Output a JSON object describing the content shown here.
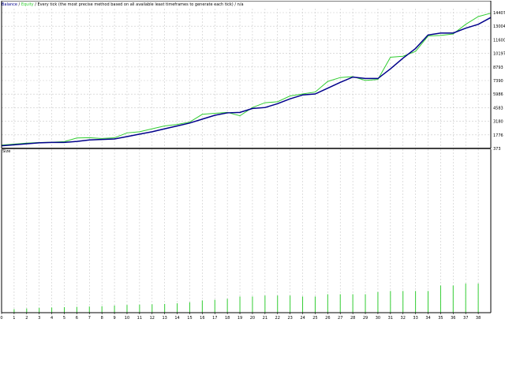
{
  "header": {
    "balance_label": "Balance",
    "sep1": " / ",
    "equity_label": "Equity",
    "sep2": " / ",
    "model_text": "Every tick (the most precise method based on all available least timeframes to generate each tick)",
    "sep3": " / ",
    "tail_text": "n/a"
  },
  "colors": {
    "balance": "#00008b",
    "equity": "#32cd32",
    "size_bars": "#32cd32",
    "grid": "#c8c8c8",
    "axis": "#000000"
  },
  "chart_data": [
    {
      "type": "line",
      "title": "",
      "xlabel": "",
      "ylabel": "",
      "ylim": [
        373,
        14407
      ],
      "yticks": [
        "14407",
        "13004",
        "11600",
        "10197",
        "8793",
        "7390",
        "5986",
        "4583",
        "3180",
        "1776",
        "373"
      ],
      "x": [
        0,
        1,
        2,
        3,
        4,
        5,
        6,
        7,
        8,
        9,
        10,
        11,
        12,
        13,
        14,
        15,
        16,
        17,
        18,
        19,
        20,
        21,
        22,
        23,
        24,
        25,
        26,
        27,
        28,
        29,
        30,
        31,
        32,
        33,
        34,
        35,
        36,
        37,
        38,
        39
      ],
      "series": [
        {
          "name": "Balance",
          "color": "#00008b",
          "values": [
            650,
            750,
            850,
            950,
            1000,
            1000,
            1100,
            1250,
            1300,
            1350,
            1600,
            1850,
            2100,
            2400,
            2700,
            3000,
            3400,
            3800,
            4050,
            4100,
            4500,
            4600,
            5000,
            5500,
            5900,
            6000,
            6600,
            7200,
            7750,
            7600,
            7600,
            8600,
            9700,
            10700,
            12100,
            12300,
            12300,
            12800,
            13200,
            13900
          ]
        },
        {
          "name": "Equity",
          "color": "#32cd32",
          "values": [
            720,
            820,
            920,
            990,
            1020,
            1080,
            1450,
            1480,
            1400,
            1470,
            1980,
            2100,
            2400,
            2700,
            2850,
            3100,
            3900,
            4000,
            4100,
            3750,
            4600,
            5100,
            5200,
            5800,
            6000,
            6200,
            7300,
            7700,
            7800,
            7400,
            7500,
            9800,
            9900,
            10400,
            12000,
            12050,
            12200,
            13200,
            14000,
            14350
          ]
        }
      ]
    },
    {
      "type": "bar",
      "title": "Size",
      "xlabel": "",
      "ylabel": "",
      "ylim": [
        0,
        1
      ],
      "xticks": [
        "0",
        "1",
        "2",
        "3",
        "4",
        "5",
        "6",
        "7",
        "8",
        "9",
        "10",
        "11",
        "12",
        "13",
        "14",
        "15",
        "16",
        "17",
        "18",
        "19",
        "20",
        "21",
        "22",
        "23",
        "24",
        "25",
        "26",
        "27",
        "28",
        "29",
        "30",
        "31",
        "32",
        "33",
        "34",
        "35",
        "36",
        "37",
        "38"
      ],
      "series": [
        {
          "name": "Size",
          "color": "#32cd32",
          "values": [
            0.08,
            0.11,
            0.13,
            0.15,
            0.16,
            0.17,
            0.18,
            0.19,
            0.2,
            0.22,
            0.24,
            0.25,
            0.26,
            0.27,
            0.29,
            0.32,
            0.38,
            0.4,
            0.43,
            0.5,
            0.5,
            0.53,
            0.53,
            0.53,
            0.5,
            0.5,
            0.57,
            0.57,
            0.57,
            0.57,
            0.64,
            0.67,
            0.67,
            0.67,
            0.67,
            0.84,
            0.84,
            0.9,
            0.9,
            0.95
          ]
        }
      ]
    }
  ]
}
